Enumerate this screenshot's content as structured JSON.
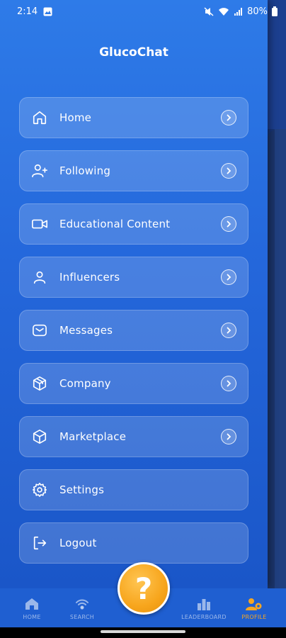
{
  "status_bar": {
    "time": "2:14",
    "battery": "80%"
  },
  "drawer": {
    "title": "GlucoChat",
    "items": [
      {
        "label": "Home",
        "icon": "home-icon",
        "has_chevron": true
      },
      {
        "label": "Following",
        "icon": "user-plus-icon",
        "has_chevron": true
      },
      {
        "label": "Educational Content",
        "icon": "video-icon",
        "has_chevron": true
      },
      {
        "label": "Influencers",
        "icon": "user-icon",
        "has_chevron": true
      },
      {
        "label": "Messages",
        "icon": "mail-icon",
        "has_chevron": true
      },
      {
        "label": "Company",
        "icon": "box-icon",
        "has_chevron": true
      },
      {
        "label": "Marketplace",
        "icon": "cube-icon",
        "has_chevron": true
      },
      {
        "label": "Settings",
        "icon": "gear-icon",
        "has_chevron": false
      },
      {
        "label": "Logout",
        "icon": "logout-icon",
        "has_chevron": false
      }
    ]
  },
  "bottom_nav": {
    "items": [
      {
        "label": "HOME",
        "icon": "home-icon",
        "active": false
      },
      {
        "label": "SEARCH",
        "icon": "wifi-search-icon",
        "active": false
      },
      {
        "label": "LEADERBOARD",
        "icon": "bar-chart-icon",
        "active": false
      },
      {
        "label": "PROFILE",
        "icon": "profile-gear-icon",
        "active": true
      }
    ],
    "fab_symbol": "?"
  },
  "colors": {
    "drawer_top": "#2e7be8",
    "drawer_bottom": "#1a56c8",
    "accent": "#f5a623",
    "nav_bg": "#1f5fd1"
  }
}
